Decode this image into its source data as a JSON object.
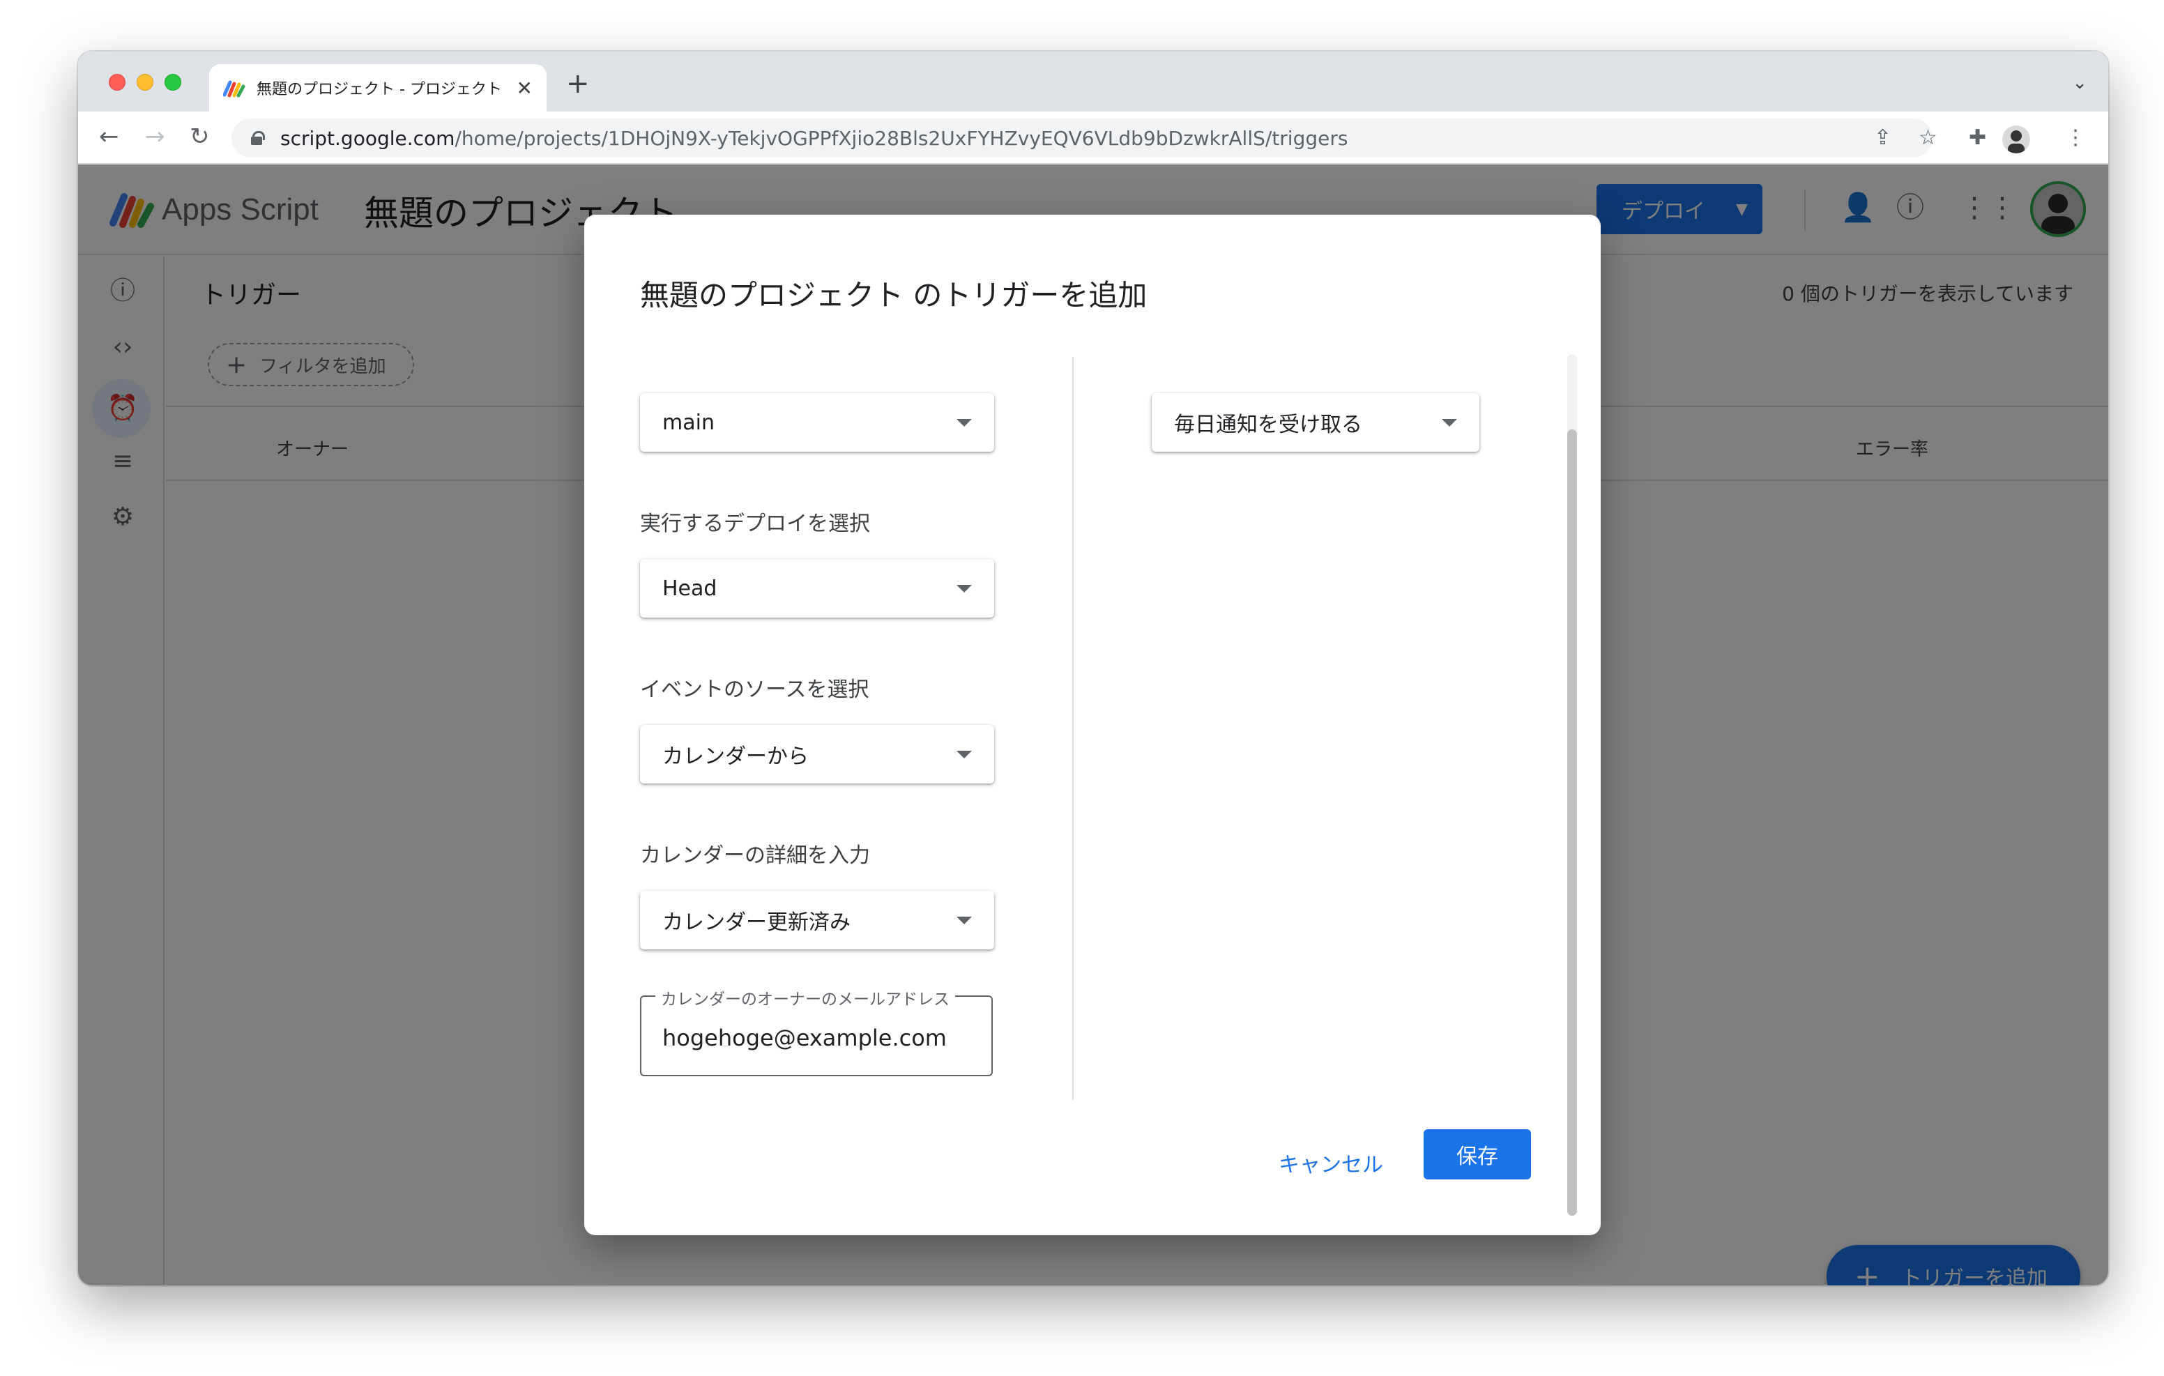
{
  "browser": {
    "tab_title": "無題のプロジェクト - プロジェクト",
    "tab_close": "✕",
    "new_tab": "+",
    "url_host": "script.google.com",
    "url_path": "/home/projects/1DHOjN9X-yTekjvOGPPfXjio28Bls2UxFYHZvyEQV6VLdb9bDzwkrAllS/triggers"
  },
  "app": {
    "name": "Apps Script",
    "project_title": "無題のプロジェクト",
    "deploy_label": "デプロイ"
  },
  "page": {
    "title": "トリガー",
    "trigger_count": "0 個のトリガーを表示しています",
    "filter_label": "フィルタを追加",
    "columns": [
      "オーナー",
      "エラー率"
    ],
    "fab_label": "トリガーを追加"
  },
  "dialog": {
    "title": "無題のプロジェクト のトリガーを追加",
    "function_select": "main",
    "deploy_label": "実行するデプロイを選択",
    "deploy_select": "Head",
    "event_source_label": "イベントのソースを選択",
    "event_source_select": "カレンダーから",
    "calendar_detail_label": "カレンダーの詳細を入力",
    "calendar_detail_select": "カレンダー更新済み",
    "owner_email_label": "カレンダーのオーナーのメールアドレス",
    "owner_email_value": "hogehoge@example.com",
    "notify_select": "毎日通知を受け取る",
    "cancel_label": "キャンセル",
    "save_label": "保存"
  },
  "colors": {
    "accent": "#1a73e8",
    "scrim": "rgba(0,0,0,0.5)"
  }
}
